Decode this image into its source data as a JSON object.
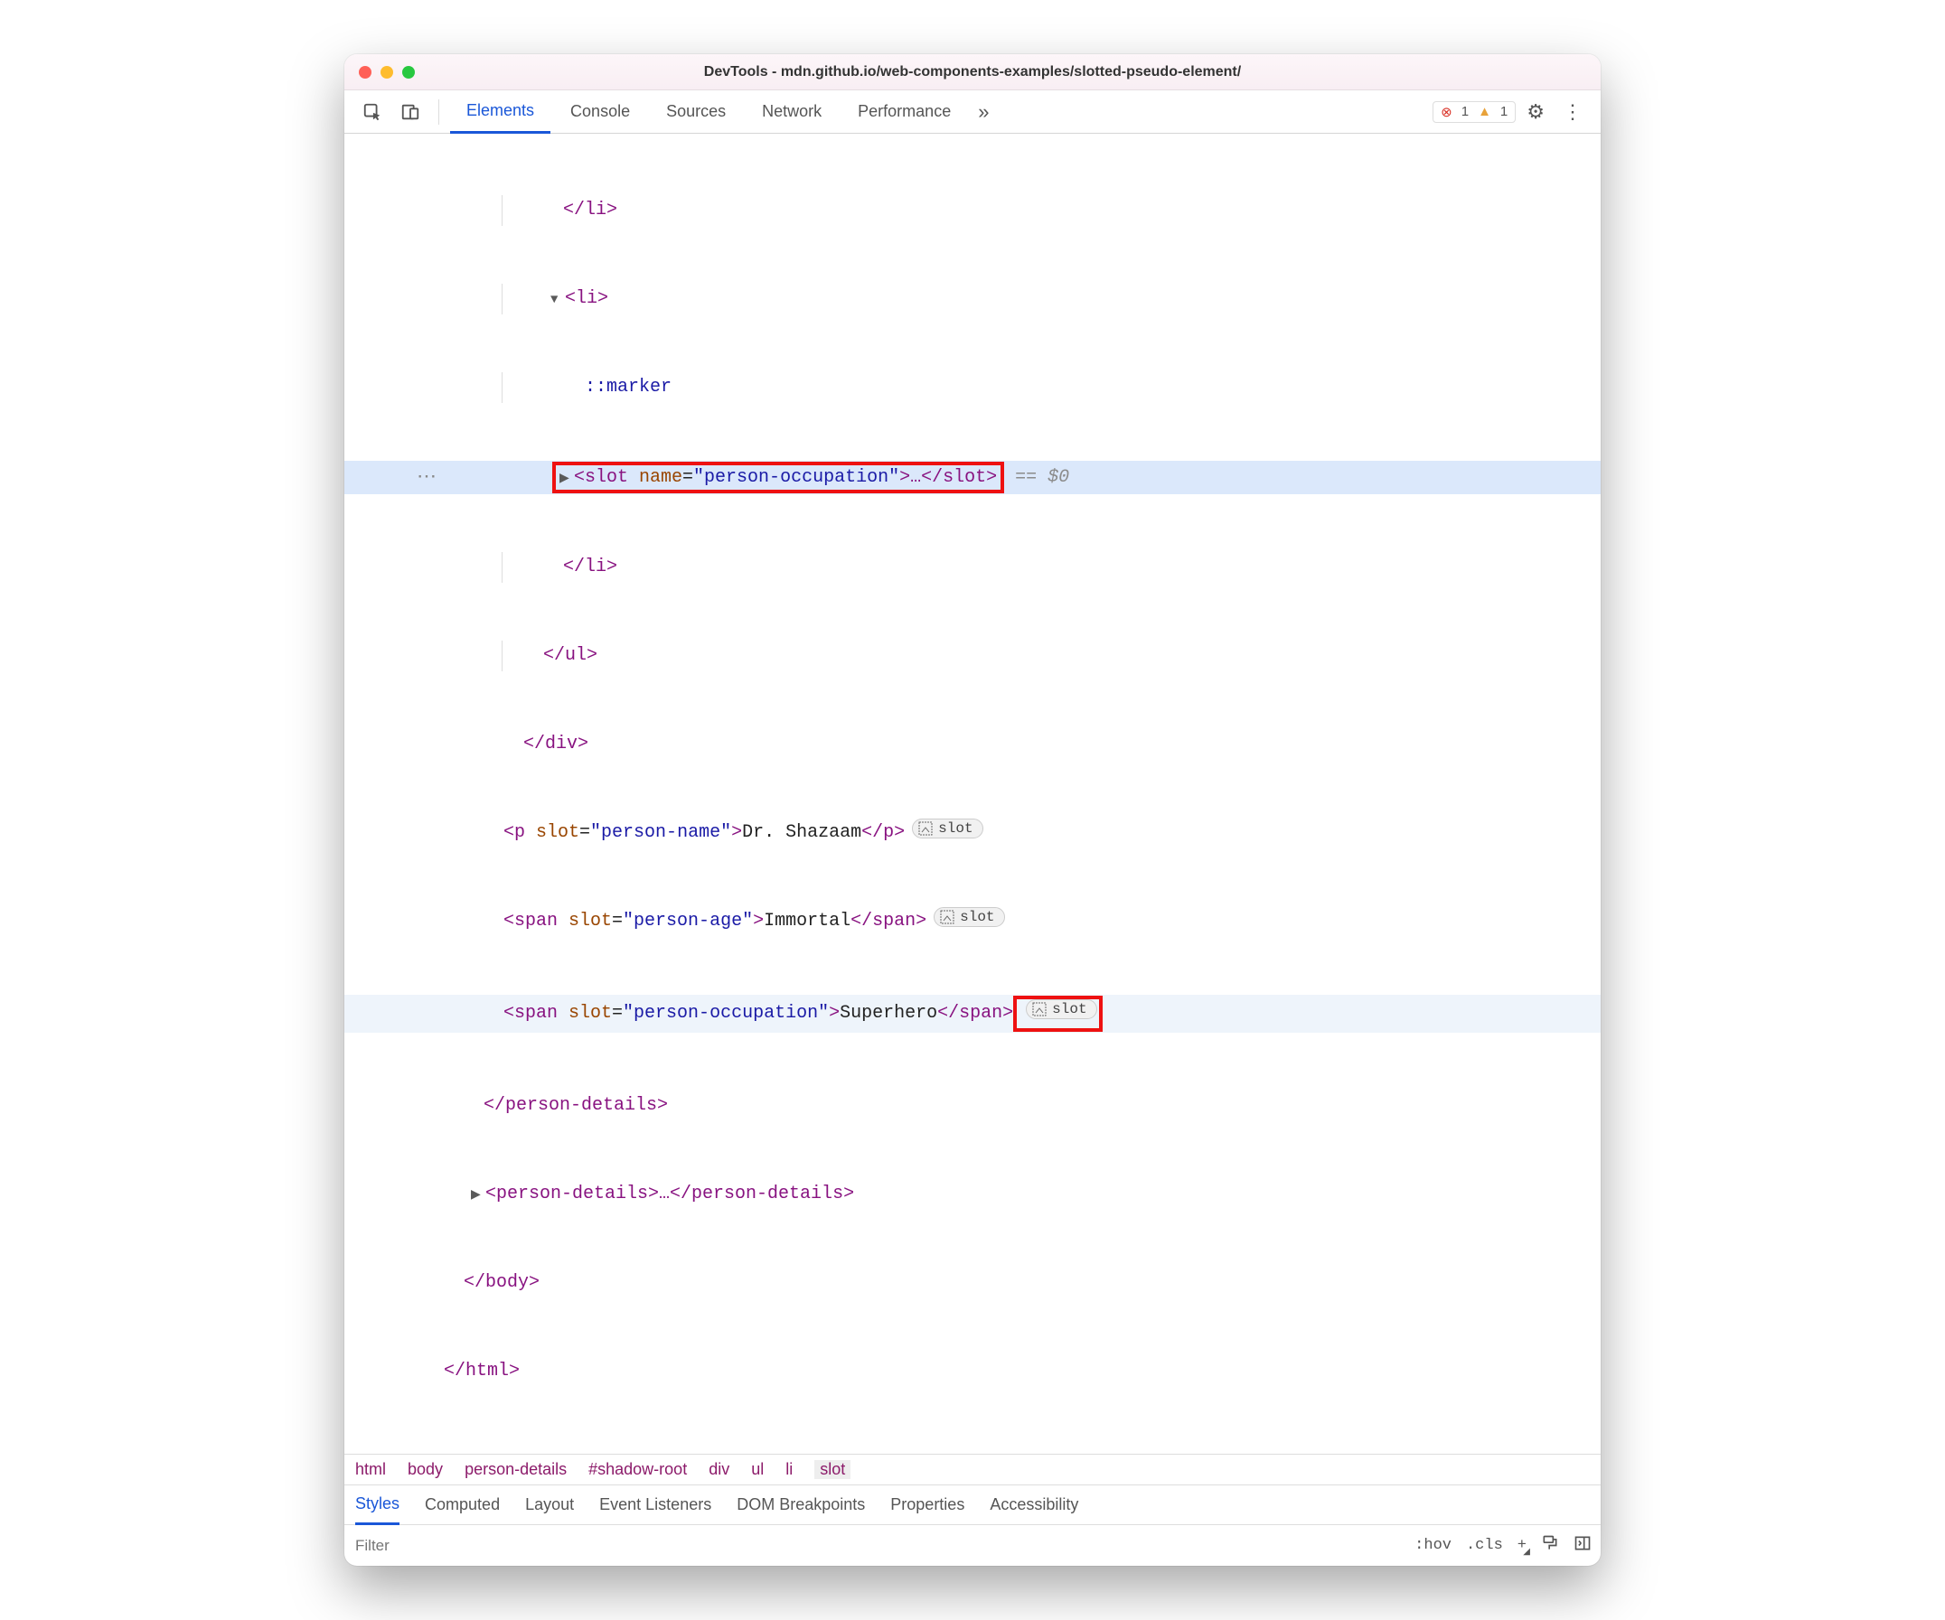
{
  "window_title": "DevTools - mdn.github.io/web-components-examples/slotted-pseudo-element/",
  "tabs": [
    "Elements",
    "Console",
    "Sources",
    "Network",
    "Performance"
  ],
  "active_tab": "Elements",
  "issues": {
    "errors": "1",
    "warnings": "1"
  },
  "dom": {
    "li_close_1": "</li>",
    "li_open": "<li>",
    "marker": "::marker",
    "slot_open": "<slot ",
    "slot_name_attr": "name",
    "slot_name_val": "\"person-occupation\"",
    "slot_close": ">…</slot>",
    "eq0": "== $0",
    "li_close_2": "</li>",
    "ul_close": "</ul>",
    "div_close": "</div>",
    "p_open": "<p ",
    "p_attr": "slot",
    "p_val": "\"person-name\"",
    "p_text": "Dr. Shazaam",
    "p_close": "</p>",
    "span1_open": "<span ",
    "span1_attr": "slot",
    "span1_val": "\"person-age\"",
    "span1_text": "Immortal",
    "span1_close": "</span>",
    "span2_open": "<span ",
    "span2_attr": "slot",
    "span2_val": "\"person-occupation\"",
    "span2_text": "Superhero",
    "span2_close": "</span>",
    "pd_close": "</person-details>",
    "pd2": "<person-details>…</person-details>",
    "body_close": "</body>",
    "html_close": "</html>"
  },
  "slot_badge": "slot",
  "breadcrumbs": [
    "html",
    "body",
    "person-details",
    "#shadow-root",
    "div",
    "ul",
    "li",
    "slot"
  ],
  "breadcrumb_selected": "slot",
  "subtabs": [
    "Styles",
    "Computed",
    "Layout",
    "Event Listeners",
    "DOM Breakpoints",
    "Properties",
    "Accessibility"
  ],
  "subtab_active": "Styles",
  "filter_placeholder": "Filter",
  "hov": ":hov",
  "cls": ".cls"
}
